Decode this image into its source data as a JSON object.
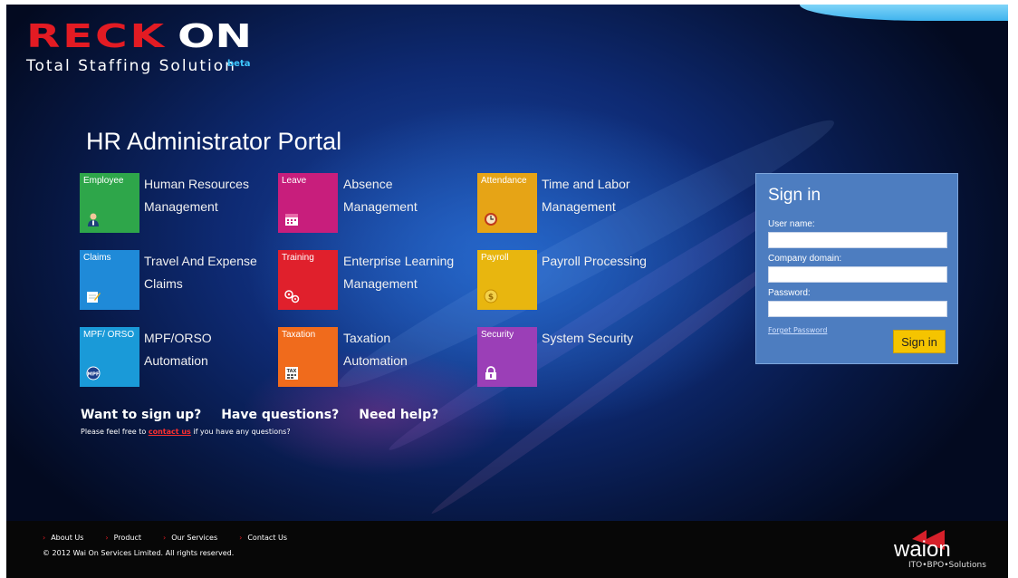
{
  "logo": {
    "brand_red": "RECK",
    "brand_white": "ON",
    "tagline": "Total Staffing Solution",
    "badge": "beta"
  },
  "portal_title": "HR Administrator Portal",
  "modules": [
    {
      "tile": "Employee",
      "title_line1": "Human Resources",
      "title_line2": "Management",
      "color": "#2ea64a",
      "icon": "user-icon"
    },
    {
      "tile": "Leave",
      "title_line1": "Absence",
      "title_line2": "Management",
      "color": "#c81e7c",
      "icon": "calendar-icon"
    },
    {
      "tile": "Attendance",
      "title_line1": "Time and Labor",
      "title_line2": "Management",
      "color": "#e6a416",
      "icon": "clock-icon"
    },
    {
      "tile": "Claims",
      "title_line1": "Travel And Expense",
      "title_line2": "Claims",
      "color": "#1f8ad8",
      "icon": "note-icon"
    },
    {
      "tile": "Training",
      "title_line1": "Enterprise Learning",
      "title_line2": "Management",
      "color": "#e0202c",
      "icon": "gears-icon"
    },
    {
      "tile": "Payroll",
      "title_line1": "Payroll Processing",
      "title_line2": "",
      "color": "#e8b60f",
      "icon": "coin-icon"
    },
    {
      "tile": "MPF/ ORSO",
      "title_line1": "MPF/ORSO",
      "title_line2": "Automation",
      "color": "#1a9ad8",
      "icon": "mpf-icon"
    },
    {
      "tile": "Taxation",
      "title_line1": "Taxation",
      "title_line2": "Automation",
      "color": "#f06b1c",
      "icon": "tax-icon"
    },
    {
      "tile": "Security",
      "title_line1": "System Security",
      "title_line2": "",
      "color": "#9b3fb7",
      "icon": "lock-icon"
    }
  ],
  "signin": {
    "title": "Sign in",
    "username_label": "User name:",
    "domain_label": "Company domain:",
    "password_label": "Password:",
    "forgot": "Forget Password",
    "button": "Sign in"
  },
  "cta": {
    "q1": "Want to sign up?",
    "q2": "Have questions?",
    "q3": "Need help?",
    "sub_prefix": "Please feel free to",
    "sub_link": "contact us",
    "sub_suffix": "if you have any questions?"
  },
  "footer": {
    "nav": [
      "About Us",
      "Product",
      "Our Services",
      "Contact Us"
    ],
    "copyright": "© 2012 Wai On Services Limited. All rights reserved.",
    "waion_word": "waion",
    "waion_tagline": "ITO•BPO•Solutions"
  }
}
